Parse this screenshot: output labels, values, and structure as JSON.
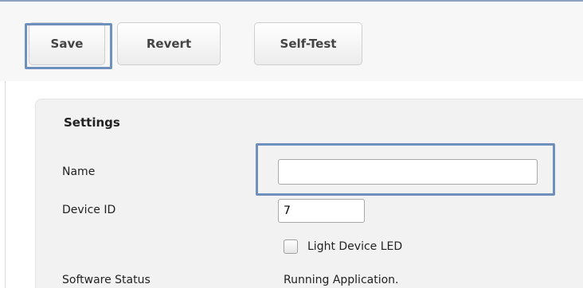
{
  "toolbar": {
    "save_label": "Save",
    "revert_label": "Revert",
    "selftest_label": "Self-Test"
  },
  "settings": {
    "title": "Settings",
    "name_label": "Name",
    "name_value": "",
    "device_id_label": "Device ID",
    "device_id_value": "7",
    "led_checkbox_label": "Light Device LED",
    "led_checked": false,
    "software_status_label": "Software Status",
    "software_status_value": "Running Application."
  },
  "colors": {
    "highlight": "#6f8fbd",
    "panel_bg": "#f2f2f2"
  }
}
